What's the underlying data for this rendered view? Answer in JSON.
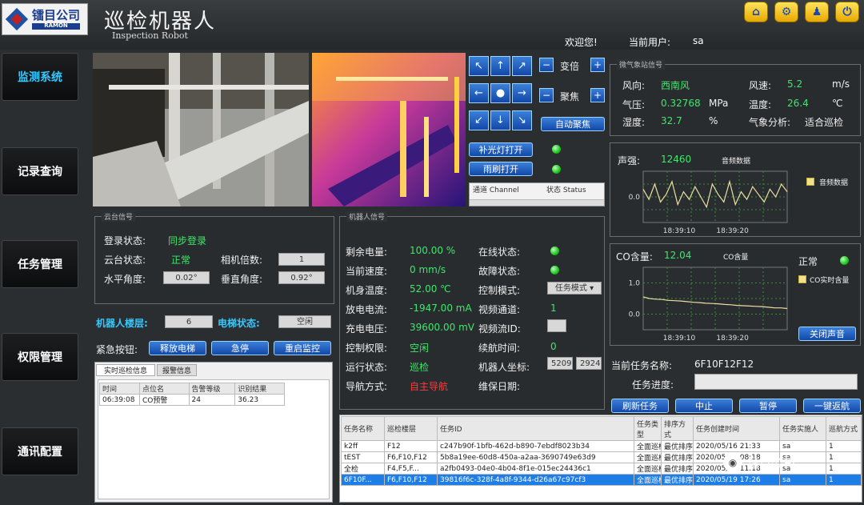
{
  "header": {
    "logo_text": "镭目公司",
    "title": "巡检机器人",
    "subtitle": "Inspection Robot",
    "welcome": "欢迎您!",
    "current_user_label": "当前用户:",
    "current_user": "sa"
  },
  "sidebar": {
    "items": [
      {
        "label": "监测系统"
      },
      {
        "label": "记录查询"
      },
      {
        "label": "任务管理"
      },
      {
        "label": "权限管理"
      },
      {
        "label": "通讯配置"
      }
    ]
  },
  "ptz": {
    "zoom_label": "变倍",
    "focus_label": "聚焦",
    "auto_focus": "自动聚焦",
    "fill_light": "补光灯打开",
    "wiper": "雨刷打开",
    "channel_col": "通道 Channel",
    "status_col": "状态 Status"
  },
  "weather": {
    "title": "微气象站信号",
    "wind_dir_label": "风向:",
    "wind_dir": "西南风",
    "wind_speed_label": "风速:",
    "wind_speed": "5.2",
    "wind_speed_unit": "m/s",
    "pressure_label": "气压:",
    "pressure": "0.32768",
    "pressure_unit": "MPa",
    "temp_label": "温度:",
    "temp": "26.4",
    "temp_unit": "℃",
    "humidity_label": "湿度:",
    "humidity": "32.7",
    "humidity_unit": "%",
    "analysis_label": "气象分析:",
    "analysis": "适合巡检"
  },
  "sound": {
    "label": "声强:",
    "value": "12460",
    "chart_title": "音频数据",
    "legend": "音频数据"
  },
  "co": {
    "label": "CO含量:",
    "value": "12.04",
    "chart_title": "CO含量",
    "status": "正常",
    "legend": "CO实时含量",
    "close_sound": "关闭声音"
  },
  "chart_data": [
    {
      "type": "line",
      "x": [
        "18:39:10",
        "18:39:20"
      ],
      "ylim": [
        -0.5,
        0.5
      ],
      "yticks": [
        "0.0"
      ],
      "series": [
        {
          "name": "音频数据",
          "values": [
            0.15,
            -0.05,
            0.25,
            -0.1,
            0.05,
            0.3,
            -0.15,
            0.1,
            -0.05,
            0.2,
            0.0,
            -0.2,
            0.25,
            0.05,
            -0.1,
            0.3,
            -0.15,
            0.1,
            -0.05,
            0.2,
            0.05,
            -0.1,
            0.15,
            0.0,
            0.25,
            0.1
          ]
        }
      ]
    },
    {
      "type": "line",
      "x": [
        "18:39:10",
        "18:39:20"
      ],
      "ylim": [
        -0.5,
        1.5
      ],
      "yticks": [
        "1.0",
        "0.0"
      ],
      "series": [
        {
          "name": "CO实时含量",
          "values": [
            0.55,
            0.5,
            0.48,
            0.47,
            0.44,
            0.43,
            0.42,
            0.4,
            0.38,
            0.37,
            0.35,
            0.34,
            0.33,
            0.31,
            0.3,
            0.28,
            0.27,
            0.26,
            0.25,
            0.24,
            0.22,
            0.2,
            0.2,
            0.18
          ]
        }
      ]
    }
  ],
  "gimbal": {
    "title": "云台信号",
    "login_label": "登录状态:",
    "login_value": "同步登录",
    "state_label": "云台状态:",
    "state_value": "正常",
    "zoom_label": "相机倍数:",
    "zoom_value": "1",
    "h_angle_label": "水平角度:",
    "h_angle_value": "0.02°",
    "v_angle_label": "垂直角度:",
    "v_angle_value": "0.92°"
  },
  "robot_floor": {
    "floor_label": "机器人楼层:",
    "floor_value": "6",
    "elevator_label": "电梯状态:",
    "elevator_value": "空闲"
  },
  "emergency": {
    "label": "紧急按钮:",
    "release_elevator": "释放电梯",
    "stop": "急停",
    "restart_monitor": "重启监控"
  },
  "alarm_tabs": [
    "实时巡检信息",
    "报警信息"
  ],
  "alarm_table": {
    "headers": [
      "时间",
      "点位名",
      "告警等级",
      "识别结果"
    ],
    "rows": [
      [
        "06:39:08",
        "CO预警",
        "24",
        "36.23"
      ]
    ]
  },
  "robot": {
    "title": "机器人信号",
    "battery_label": "剩余电量:",
    "battery_value": "100.00 %",
    "online_label": "在线状态:",
    "speed_label": "当前速度:",
    "speed_value": "0 mm/s",
    "fault_label": "故障状态:",
    "body_temp_label": "机身温度:",
    "body_temp_value": "52.00 ℃",
    "control_label": "控制模式:",
    "control_value": "任务模式",
    "discharge_label": "放电电流:",
    "discharge_value": "-1947.00 mA",
    "video_channel_label": "视频通道:",
    "video_channel_value": "1",
    "charge_label": "充电电压:",
    "charge_value": "39600.00 mV",
    "video_stream_label": "视频流ID:",
    "video_stream_value": "",
    "permission_label": "控制权限:",
    "permission_value": "空闲",
    "endurance_label": "续航时间:",
    "endurance_value": "0",
    "run_state_label": "运行状态:",
    "run_state_value": "巡检",
    "coord_label": "机器人坐标:",
    "coord_x": "5209",
    "coord_y": "2924",
    "nav_label": "导航方式:",
    "nav_value": "自主导航",
    "maintenance_label": "维保日期:"
  },
  "task": {
    "name_label": "当前任务名称:",
    "name_value": "6F10F12F12",
    "progress_label": "任务进度:",
    "progress": 0,
    "refresh": "刷新任务",
    "abort": "中止",
    "pause": "暂停",
    "return": "一键返航"
  },
  "task_table": {
    "headers": [
      "任务名称",
      "巡检楼层",
      "任务ID",
      "任务类型",
      "排序方式",
      "任务创建时间",
      "任务实施人",
      "巡航方式"
    ],
    "rows": [
      [
        "k2ff",
        "F12",
        "c247b90f-1bfb-462d-b890-7ebdf8023b34",
        "全面巡检",
        "最优排序",
        "2020/05/16 21:33",
        "sa",
        "1"
      ],
      [
        "tEST",
        "F6,F10,F12",
        "5b8a19ee-60d8-450a-a2aa-3690749e63d9",
        "全面巡检",
        "最优排序",
        "2020/05/18 08:18",
        "sa",
        "1"
      ],
      [
        "全检",
        "F4,F5,F...",
        "a2fb0493-04e0-4b04-8f1e-015ec24436c1",
        "全面巡检",
        "最优排序",
        "2020/05/19 11:18",
        "sa",
        "1"
      ],
      [
        "6F10F...",
        "F6,F10,F12",
        "39816f6c-328f-4a8f-9344-d26a67c97cf3",
        "全面巡检",
        "最优排序",
        "2020/05/19 17:26",
        "sa",
        "1"
      ]
    ]
  },
  "watermark": "镭目公司"
}
